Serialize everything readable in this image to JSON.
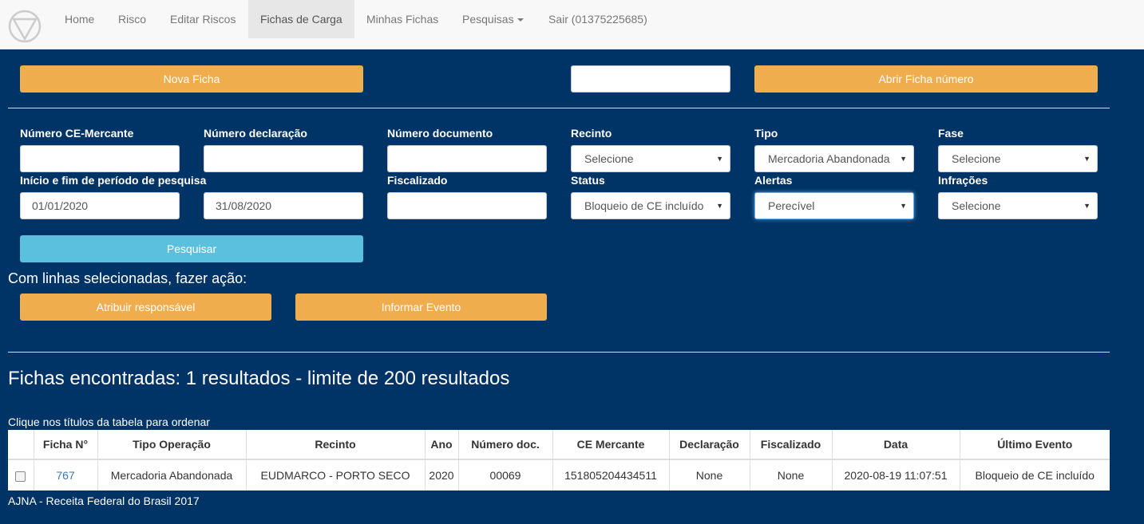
{
  "nav": {
    "items": [
      {
        "label": "Home"
      },
      {
        "label": "Risco"
      },
      {
        "label": "Editar Riscos"
      },
      {
        "label": "Fichas de Carga"
      },
      {
        "label": "Minhas Fichas"
      },
      {
        "label": "Pesquisas"
      },
      {
        "label": "Sair (01375225685)"
      }
    ],
    "active": "Fichas de Carga"
  },
  "top_actions": {
    "nova_ficha": "Nova Ficha",
    "ficha_numero_value": "",
    "abrir_ficha": "Abrir Ficha número"
  },
  "filters": {
    "numero_ce": {
      "label": "Número CE-Mercante",
      "value": ""
    },
    "numero_declaracao": {
      "label": "Número declaração",
      "value": ""
    },
    "numero_documento": {
      "label": "Número documento",
      "value": ""
    },
    "recinto": {
      "label": "Recinto",
      "value": "Selecione"
    },
    "tipo": {
      "label": "Tipo",
      "value": "Mercadoria Abandonada"
    },
    "fase": {
      "label": "Fase",
      "value": "Selecione"
    },
    "periodo": {
      "label": "Início e fim de período de pesquisa",
      "start": "01/01/2020",
      "end": "31/08/2020"
    },
    "fiscalizado": {
      "label": "Fiscalizado",
      "value": ""
    },
    "status": {
      "label": "Status",
      "value": "Bloqueio de CE incluído"
    },
    "alertas": {
      "label": "Alertas",
      "value": "Perecível"
    },
    "infracoes": {
      "label": "Infrações",
      "value": "Selecione"
    }
  },
  "search_button": "Pesquisar",
  "bulk": {
    "title": "Com linhas selecionadas, fazer ação:",
    "atribuir": "Atribuir responsável",
    "informar": "Informar Evento"
  },
  "results": {
    "heading": "Fichas encontradas: 1 resultados - limite de 200 resultados",
    "hint": "Clique nos títulos da tabela para ordenar",
    "columns": [
      "",
      "Ficha N°",
      "Tipo Operação",
      "Recinto",
      "Ano",
      "Número doc.",
      "CE Mercante",
      "Declaração",
      "Fiscalizado",
      "Data",
      "Último Evento"
    ],
    "rows": [
      {
        "ficha": "767",
        "tipo": "Mercadoria Abandonada",
        "recinto": "EUDMARCO - PORTO SECO",
        "ano": "2020",
        "numero_doc": "00069",
        "ce": "151805204434511",
        "declaracao": "None",
        "fiscalizado": "None",
        "data": "2020-08-19 11:07:51",
        "ultimo_evento": "Bloqueio de CE incluído"
      }
    ]
  },
  "footer": "AJNA - Receita Federal do Brasil 2017"
}
